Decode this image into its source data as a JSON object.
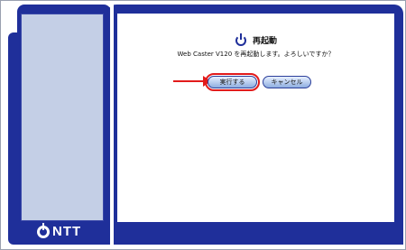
{
  "dialog": {
    "title": "再起動",
    "message": "Web Caster V120 を再起動します。よろしいですか？",
    "execute_label": "実行する",
    "cancel_label": "キャンセル"
  },
  "branding": {
    "logo_text": "NTT"
  },
  "colors": {
    "frame_blue": "#1f2f9a",
    "sidebar_light": "#c4cfe6",
    "highlight_red": "#e21b1b"
  },
  "icons": {
    "title_icon": "power-icon",
    "annotation": "red-arrow-icon"
  }
}
